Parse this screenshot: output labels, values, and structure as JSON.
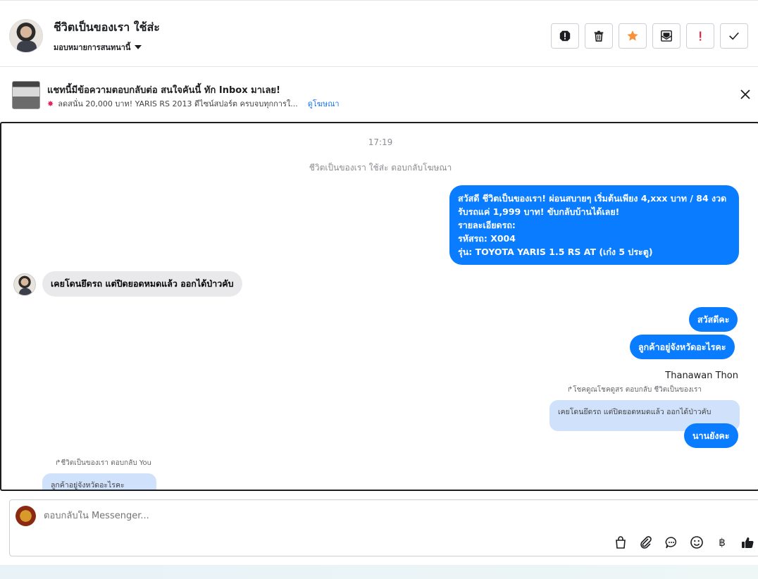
{
  "header": {
    "contact_name": "ชีวิตเป็นของเรา ใช้ส่ะ",
    "assign_label": "มอบหมายการสนทนานี้",
    "actions": [
      "report",
      "delete",
      "star",
      "mark-unread",
      "spam",
      "done"
    ],
    "star_color": "#f7923b",
    "spam_color": "#e41e3f"
  },
  "ad": {
    "title": "แชทนี้มีข้อความตอบกลับต่อ สนใจคันนี้ ทัก Inbox มาเลย!",
    "subtitle": "ลดสนั่น 20,000 บาท! YARIS RS 2013 ดีไซน์สปอร์ต ครบจบทุกการใ...",
    "link": "ดูโฆษณา"
  },
  "chat": {
    "time": "17:19",
    "ad_reply_note": "ชีวิตเป็นของเรา ใช้ส่ะ ตอบกลับโฆษณา",
    "msg1_lines": [
      "สวัสดี ชีวิตเป็นของเรา! ผ่อนสบายๆ เริ่มต้นเพียง 4,xxx  บาท / 84 งวด",
      "รับรถแค่ 1,999 บาท! ขับกลับบ้านได้เลย!",
      "รายละเอียดรถ:",
      "รหัสรถ: X004",
      "รุ่น: TOYOTA YARIS 1.5 RS AT (เก๋ง 5 ประตู)"
    ],
    "msg2": "เคยโดนยึดรถ แต่ปิดยอดหมดแล้ว ออกได้ป่าวคับ",
    "msg3": "สวัสดีคะ",
    "msg4": "ลูกค้าอยู่จังหวัดอะไรคะ",
    "sender": "Thanawan Thon",
    "reply_note": "โชคดูณโชคดูสร ตอบกลับ ชีวิตเป็นของเรา",
    "quoted": "เคยโดนยึดรถ แต่ปิดยอดหมดแล้ว ออกได้ป่าวคับ",
    "msg5": "นานยังคะ",
    "reply_note2": "ชีวิตเป็นของเรา ตอบกลับ You",
    "quoted2": "ลูกค้าอยู่จังหวัดอะไรคะ",
    "outgoing_color": "#0a7cff",
    "incoming_color": "#e9e9eb"
  },
  "composer": {
    "placeholder": "ตอบกลับใน Messenger...",
    "tools": [
      "bag-icon",
      "paperclip-icon",
      "chat-bubble-icon",
      "emoji-icon",
      "baht-icon",
      "thumbs-up-icon"
    ],
    "baht_symbol": "฿"
  }
}
